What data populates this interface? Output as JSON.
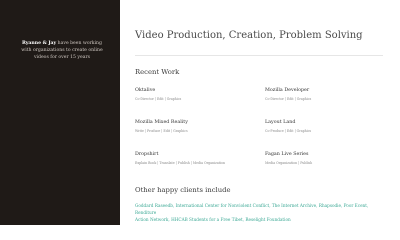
{
  "sidebar": {
    "intro_names": "Ryanne & Jay",
    "intro_line1": " have been working",
    "intro_line2": "with organizations to create online",
    "intro_line3": "videos for over 15 years"
  },
  "main": {
    "headline": "Video Production, Creation, Problem Solving",
    "recent_work_title": "Recent Work",
    "work": [
      {
        "name": "Oktalive",
        "tags": "Co-Director | Edit | Graphics"
      },
      {
        "name": "Mozilla Developer",
        "tags": "Co-Director | Edit | Graphics"
      },
      {
        "name": "Mozilla Mixed Reality",
        "tags": "Write | Produce | Edit | Graphics"
      },
      {
        "name": "Layout Land",
        "tags": "Co-Produce | Edit | Graphics"
      },
      {
        "name": "Dropshirt",
        "tags": "Explain Book | Translate | Publish | Media Organization"
      },
      {
        "name": "Fagan Live Series",
        "tags": "Media Organization | Publish"
      }
    ],
    "clients_title": "Other happy clients include",
    "clients_line1": "Goddard Raseedb, International Center for Nonviolent Conflict, The Internet Archive, Rhapsodie, Poor Ecent, Renditure",
    "clients_line2": "Action Network, HHCAB Students for a Free Tibet, Reselight Foundation"
  }
}
